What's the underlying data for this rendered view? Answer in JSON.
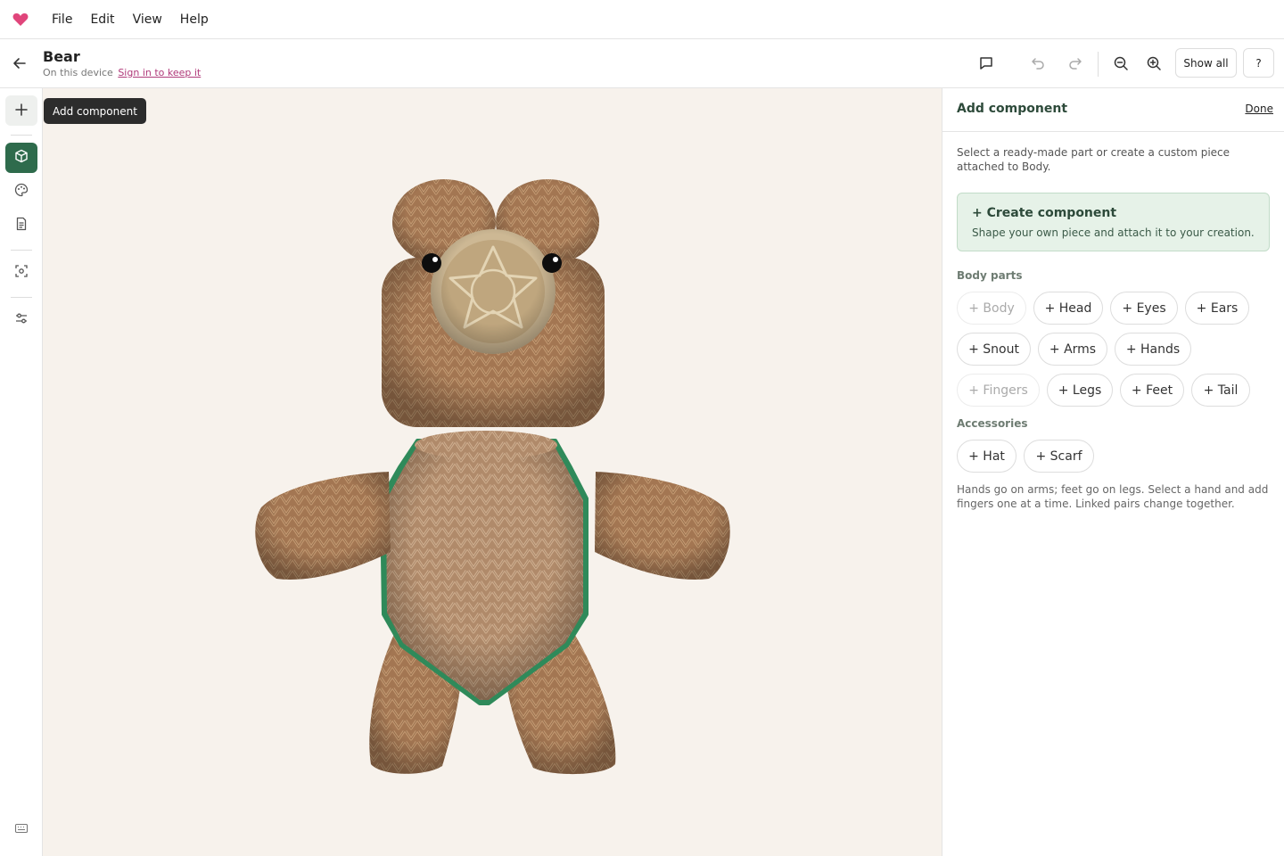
{
  "menubar": {
    "logo_icon": "heart-icon",
    "items": [
      "File",
      "Edit",
      "View",
      "Help"
    ]
  },
  "header": {
    "title": "Bear",
    "subtitle_text": "On this device",
    "subtitle_link": "Sign in to keep it",
    "show_all_label": "Show all",
    "help_label": "?",
    "icons": [
      "back-arrow-icon",
      "comment-icon",
      "undo-icon",
      "redo-icon",
      "zoom-out-icon",
      "zoom-in-icon"
    ]
  },
  "rail": {
    "tooltip": "Add component",
    "icons": [
      "plus-icon",
      "cube-icon",
      "palette-icon",
      "document-icon",
      "focus-icon",
      "sliders-icon",
      "keyboard-icon"
    ]
  },
  "panel": {
    "title": "Add component",
    "done_label": "Done",
    "description": "Select a ready-made part or create a custom piece attached to Body.",
    "create": {
      "title": "+ Create component",
      "subtitle": "Shape your own piece and attach it to your creation."
    },
    "body_parts_label": "Body parts",
    "body_parts": [
      {
        "label": "+ Body",
        "disabled": true
      },
      {
        "label": "+ Head",
        "disabled": false
      },
      {
        "label": "+ Eyes",
        "disabled": false
      },
      {
        "label": "+ Ears",
        "disabled": false
      },
      {
        "label": "+ Snout",
        "disabled": false
      },
      {
        "label": "+ Arms",
        "disabled": false
      },
      {
        "label": "+ Hands",
        "disabled": false
      },
      {
        "label": "+ Fingers",
        "disabled": true
      },
      {
        "label": "+ Legs",
        "disabled": false
      },
      {
        "label": "+ Feet",
        "disabled": false
      },
      {
        "label": "+ Tail",
        "disabled": false
      }
    ],
    "accessories_label": "Accessories",
    "accessories": [
      {
        "label": "+ Hat",
        "disabled": false
      },
      {
        "label": "+ Scarf",
        "disabled": false
      }
    ],
    "note": "Hands go on arms; feet go on legs. Select a hand and add fingers one at a time. Linked pairs change together."
  },
  "colors": {
    "accent": "#2e6b4c",
    "logo": "#e0457b",
    "canvas": "#f7f2ec",
    "yarn": "#a57a55",
    "snout": "#cdb894"
  }
}
